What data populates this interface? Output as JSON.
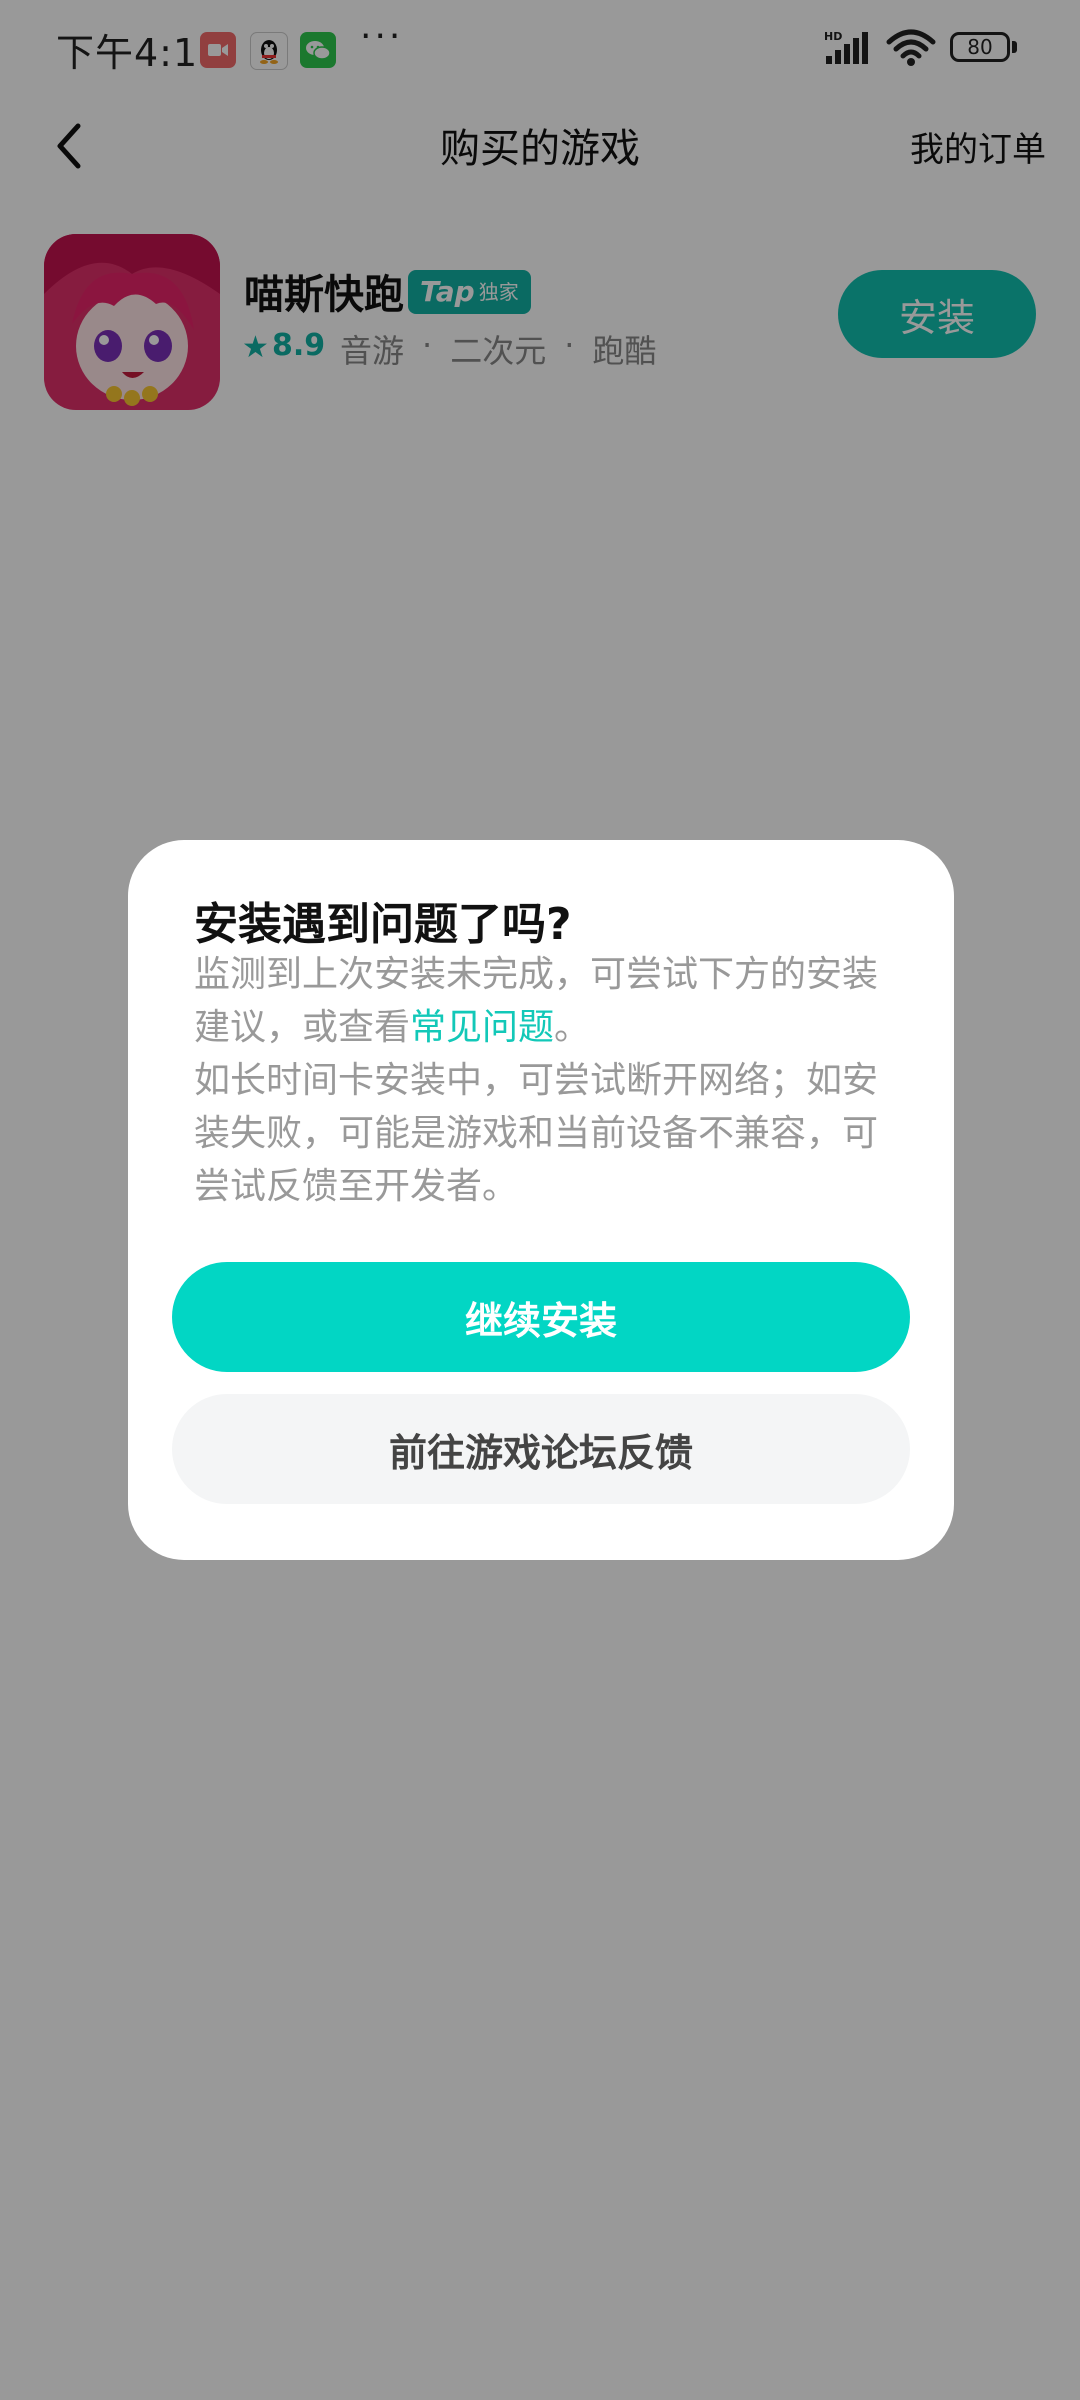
{
  "status_bar": {
    "time": "下午4:18",
    "more": "···",
    "network": "HD",
    "battery": "80"
  },
  "header": {
    "title": "购买的游戏",
    "my_orders": "我的订单"
  },
  "game": {
    "name": "喵斯快跑",
    "badge_tap": "Tap",
    "badge_exclusive": "独家",
    "rating": "8.9",
    "tags": [
      "音游",
      "·",
      "二次元",
      "·",
      "跑酷"
    ],
    "install_label": "安装"
  },
  "dialog": {
    "title": "安装遇到问题了吗?",
    "line1_a": "监测到上次安装未完成，可尝试下方的安装建议，或查看",
    "line1_link": "常见问题",
    "line1_b": "。",
    "line2": "如长时间卡安装中，可尝试断开网络；如安装失败，可能是游戏和当前设备不兼容，可尝试反馈至开发者。",
    "primary_label": "继续安装",
    "secondary_label": "前往游戏论坛反馈"
  },
  "colors": {
    "accent": "#02d6c4",
    "teal_dark": "#12b1a3",
    "overlay": "rgba(0,0,0,0.4)"
  }
}
